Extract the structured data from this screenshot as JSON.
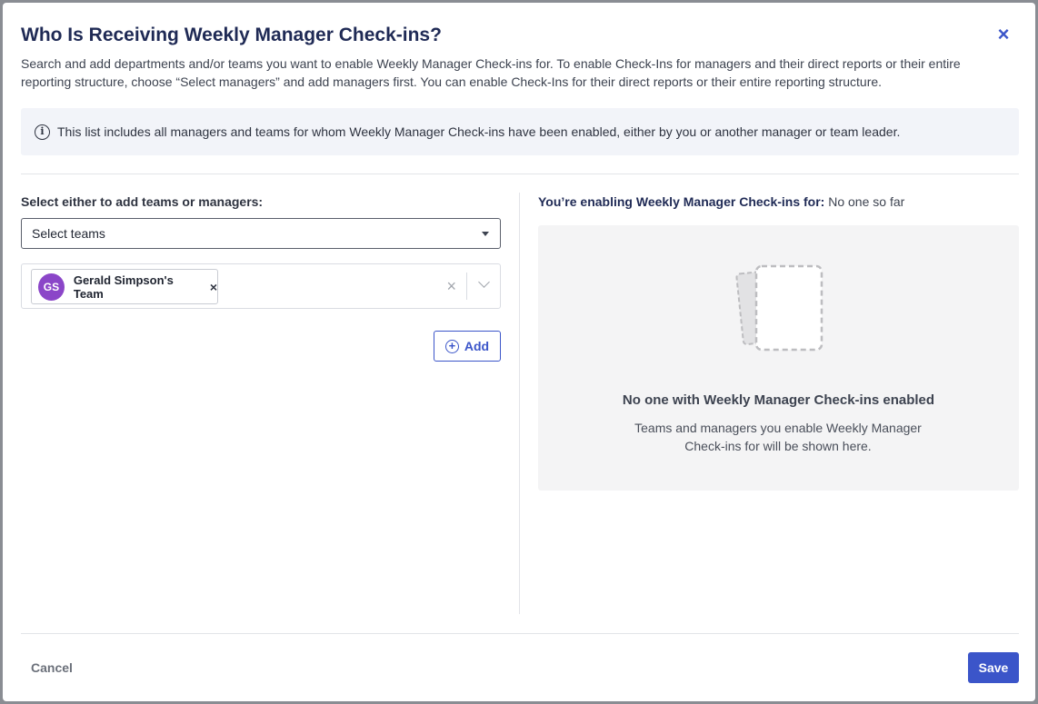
{
  "modal": {
    "title": "Who Is Receiving Weekly Manager Check-ins?",
    "close_icon": "close-icon",
    "description": "Search and add departments and/or teams you want to enable Weekly Manager Check-ins for. To enable Check-Ins for managers and their direct reports or their entire reporting structure, choose “Select managers” and add managers first. You can enable Check-Ins for their direct reports or their entire reporting structure.",
    "info_text": "This list includes all managers and teams for whom Weekly Manager Check-ins have been enabled, either by you or another manager or team leader."
  },
  "left_panel": {
    "label": "Select either to add teams or managers:",
    "select_value": "Select teams",
    "chips": [
      {
        "initials": "GS",
        "label": "Gerald Simpson's Team",
        "avatar_color": "#8b46c8"
      }
    ],
    "add_button": "Add"
  },
  "right_panel": {
    "heading_bold": "You’re enabling Weekly Manager Check-ins for:",
    "heading_value": "No one so far",
    "empty_title": "No one with Weekly Manager Check-ins enabled",
    "empty_text": "Teams and managers you enable Weekly Manager Check-ins for will be shown here."
  },
  "footer": {
    "cancel": "Cancel",
    "save": "Save"
  },
  "colors": {
    "accent": "#3b55c9",
    "title": "#1f2a55",
    "avatar": "#8b46c8",
    "info_bg": "#f2f4f9"
  }
}
